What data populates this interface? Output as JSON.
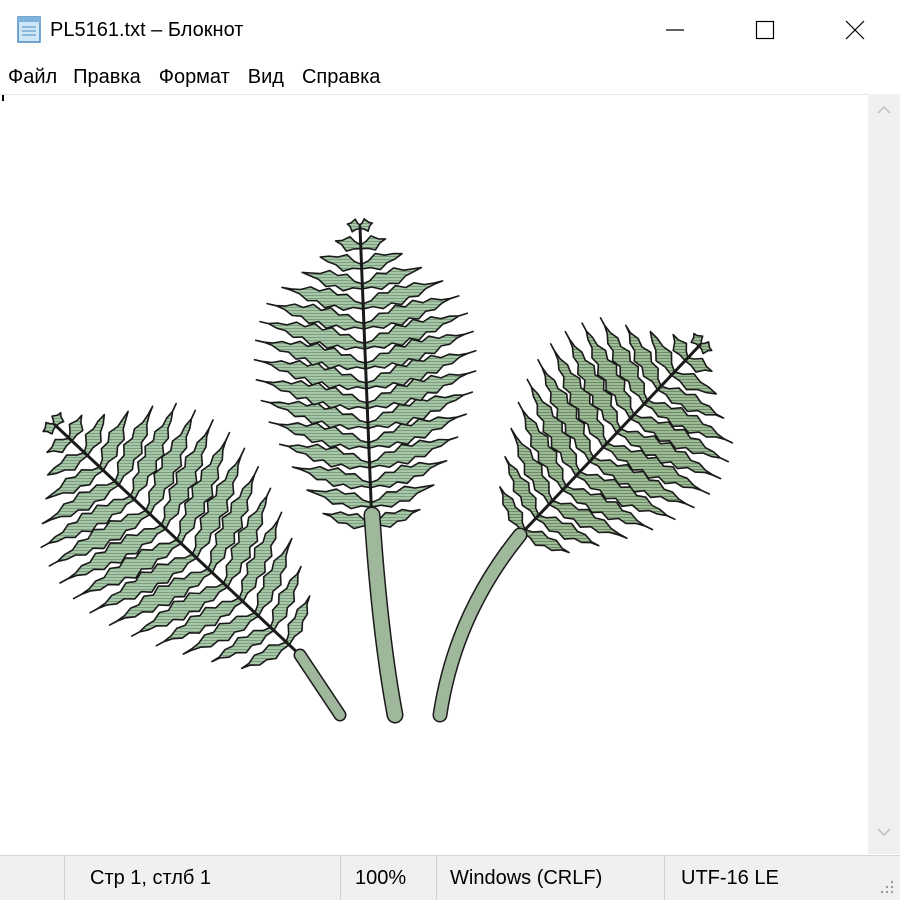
{
  "window": {
    "title": "PL5161.txt – Блокнот",
    "minimize_icon": "minimize-icon",
    "maximize_icon": "maximize-icon",
    "close_icon": "close-icon"
  },
  "menu": {
    "items": [
      "Файл",
      "Правка",
      "Формат",
      "Вид",
      "Справка"
    ]
  },
  "editor": {
    "content": "fern-leaves-illustration",
    "colors": {
      "leaf": "#a6c8a8",
      "leaf_dark": "#8fae8c",
      "outline": "#1a1a1a",
      "stem": "#9fb79a"
    }
  },
  "status": {
    "position": "Стр 1, стлб 1",
    "zoom": "100%",
    "line_ending": "Windows (CRLF)",
    "encoding": "UTF-16 LE"
  }
}
